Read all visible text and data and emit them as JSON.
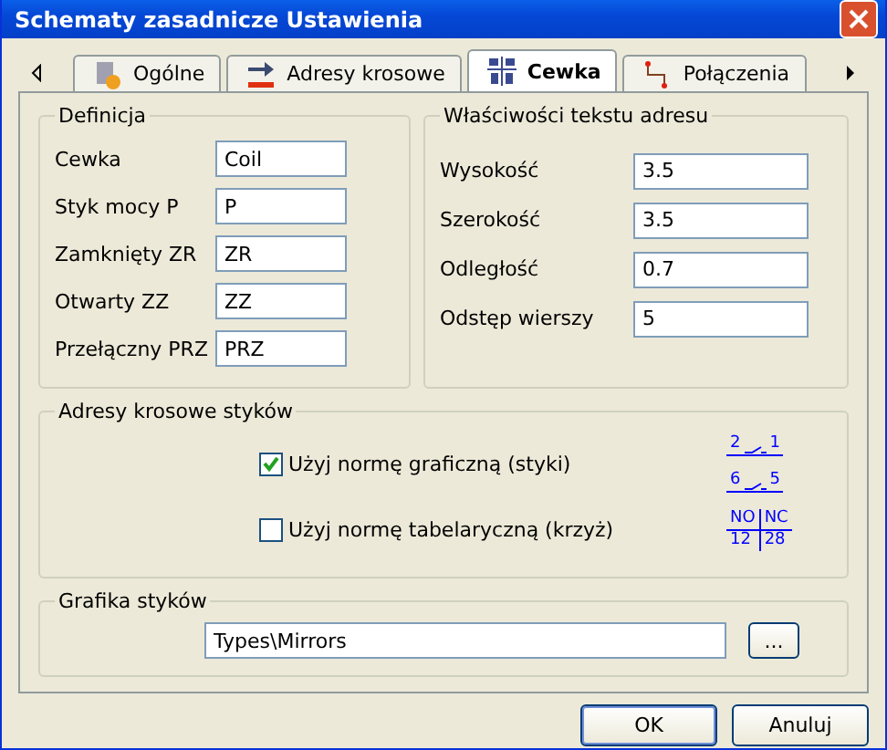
{
  "window": {
    "title": "Schematy zasadnicze Ustawienia"
  },
  "tabs": [
    {
      "label": "Ogólne",
      "selected": false
    },
    {
      "label": "Adresy krosowe",
      "selected": false
    },
    {
      "label": "Cewka",
      "selected": true
    },
    {
      "label": "Połączenia",
      "selected": false
    }
  ],
  "definition": {
    "title": "Definicja",
    "fields": [
      {
        "label": "Cewka",
        "value": "Coil"
      },
      {
        "label": "Styk mocy P",
        "value": "P"
      },
      {
        "label": "Zamknięty ZR",
        "value": "ZR"
      },
      {
        "label": "Otwarty ZZ",
        "value": "ZZ"
      },
      {
        "label": "Przełączny PRZ",
        "value": "PRZ"
      }
    ]
  },
  "text_props": {
    "title": "Właściwości tekstu adresu",
    "fields": [
      {
        "label": "Wysokość",
        "value": "3.5"
      },
      {
        "label": "Szerokość",
        "value": "3.5"
      },
      {
        "label": "Odległość",
        "value": "0.7"
      },
      {
        "label": "Odstęp wierszy",
        "value": "5"
      }
    ]
  },
  "cross_addresses": {
    "title": "Adresy krosowe styków",
    "options": [
      {
        "label": "Użyj normę graficzną (styki)",
        "checked": true,
        "kind": "graphic",
        "preview": [
          "2",
          "1",
          "6",
          "5"
        ]
      },
      {
        "label": "Użyj normę tabelaryczną (krzyż)",
        "checked": false,
        "kind": "table",
        "preview": [
          "NO",
          "NC",
          "12",
          "28"
        ]
      }
    ]
  },
  "graphics": {
    "title": "Grafika styków",
    "path": "Types\\Mirrors",
    "browse": "..."
  },
  "buttons": [
    "OK",
    "Anuluj"
  ]
}
